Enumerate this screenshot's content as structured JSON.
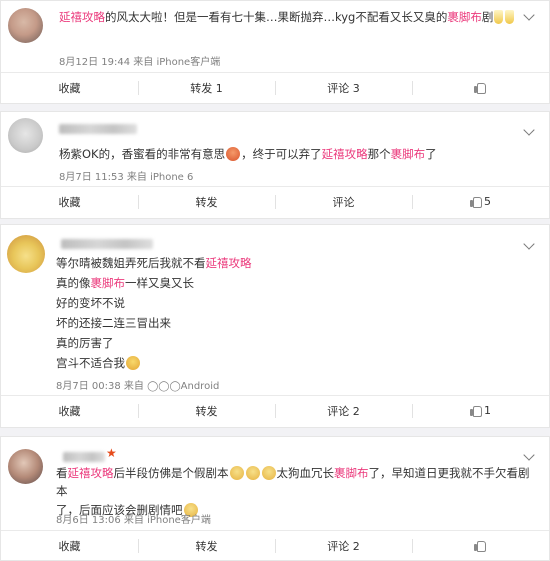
{
  "comments": [
    {
      "text_parts": [
        "",
        "延禧攻略",
        "的风太大啦！但是一看有七十集…果断抛弃…kyg不配看又长又臭的",
        "裹脚布",
        "剧"
      ],
      "meta": "8月12日 19:44 来自 iPhone客户端",
      "actions": {
        "favorite": "收藏",
        "repost": "转发 1",
        "comment": "评论 3",
        "like": ""
      }
    },
    {
      "text_parts": [
        "杨紫OK的，香蜜看的非常有意思",
        "，终于可以弃了",
        "延禧攻略",
        "那个",
        "裹脚布",
        "了"
      ],
      "meta": "8月7日 11:53 来自 iPhone 6",
      "actions": {
        "favorite": "收藏",
        "repost": "转发",
        "comment": "评论",
        "like": "5"
      }
    },
    {
      "lines": [
        [
          "等尔晴被魏姐弄死后我就不看",
          "延禧攻略"
        ],
        [
          "真的像",
          "裹脚布",
          "一样又臭又长"
        ],
        [
          "好的变坏不说"
        ],
        [
          "坏的还接二连三冒出来"
        ],
        [
          "真的厉害了"
        ],
        [
          "宫斗不适合我"
        ]
      ],
      "meta": "8月7日 00:38 来自 ◯◯◯Android",
      "actions": {
        "favorite": "收藏",
        "repost": "转发",
        "comment": "评论 2",
        "like": "1"
      }
    },
    {
      "line1": [
        "看",
        "延禧攻略",
        "后半段仿佛是个假剧本",
        "太狗血冗长",
        "裹脚布",
        "了，早知道日更我就不手欠看剧本"
      ],
      "line2": "了，后面应该会删剧情吧",
      "meta": "8月6日 13:06 来自 iPhone客户端",
      "actions": {
        "favorite": "收藏",
        "repost": "转发",
        "comment": "评论 2",
        "like": ""
      }
    }
  ]
}
